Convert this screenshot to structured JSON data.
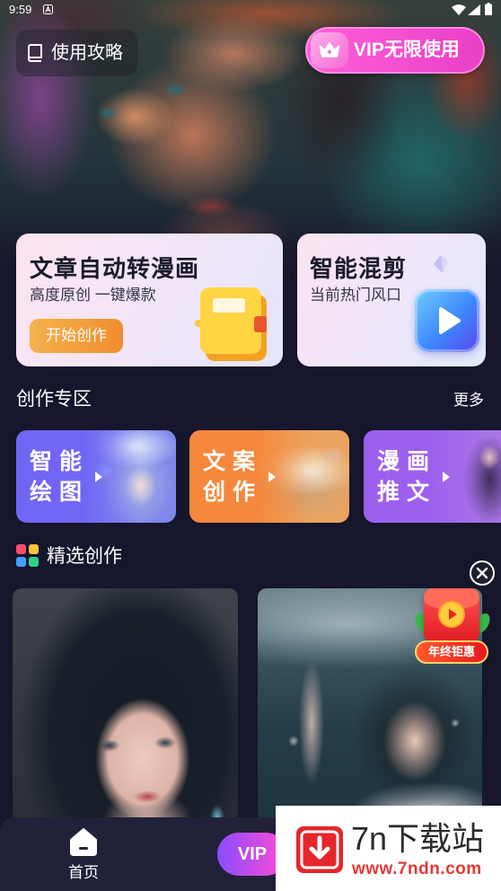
{
  "status_bar": {
    "time": "9:59",
    "icons": [
      "notification-icon",
      "wifi-icon",
      "signal-icon",
      "battery-icon"
    ]
  },
  "header": {
    "guide": {
      "label": "使用攻略",
      "icon": "book-icon"
    },
    "vip": {
      "label": "VIP无限使用",
      "icon": "crown-icon"
    }
  },
  "promo_cards": [
    {
      "title": "文章自动转漫画",
      "subtitle": "高度原创 一键爆款",
      "button": "开始创作",
      "icon": "notebook-icon"
    },
    {
      "title": "智能混剪",
      "subtitle": "当前热门风口",
      "icon": "play-icon"
    }
  ],
  "creation_zone": {
    "title": "创作专区",
    "more": "更多",
    "items": [
      {
        "line1": "智能",
        "line2": "绘图",
        "color": "#7166f4"
      },
      {
        "line1": "文案",
        "line2": "创作",
        "color": "#f5883c"
      },
      {
        "line1": "漫画",
        "line2": "推文",
        "color": "#9d60ee"
      }
    ]
  },
  "featured": {
    "title": "精选创作",
    "icon": "grid-icon",
    "close_icon": "close-icon"
  },
  "floating_promo": {
    "label": "年终钜惠",
    "icon": "red-envelope-icon"
  },
  "bottom_nav": {
    "home": {
      "label": "首页",
      "icon": "home-icon"
    },
    "vip": {
      "label": "VIP"
    }
  },
  "watermark": {
    "name": "7n下载站",
    "url": "www.7ndn.com",
    "icon": "download-icon"
  },
  "colors": {
    "background": "#16162c",
    "nav": "#22213a",
    "vip_pink": "#f24fd0",
    "start_orange": "#f19a33",
    "watermark_red": "#e53935"
  }
}
